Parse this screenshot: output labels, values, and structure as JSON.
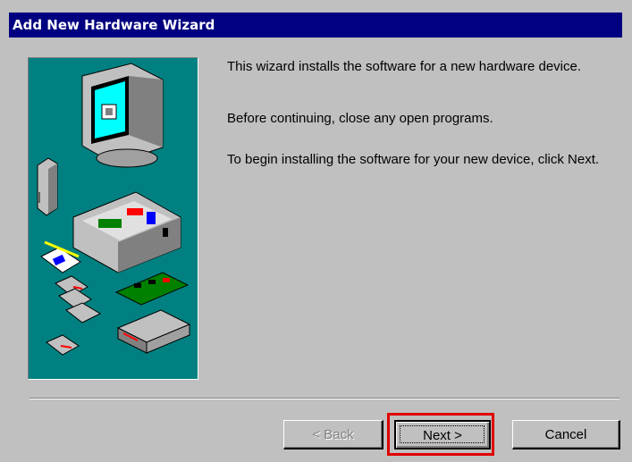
{
  "window": {
    "title": "Add New Hardware Wizard"
  },
  "body": {
    "paragraph1": "This wizard installs the software for a new hardware device.",
    "paragraph2": "Before continuing, close any open programs.",
    "paragraph3": "To begin installing the software for your new device, click Next."
  },
  "buttons": {
    "back": "< Back",
    "back_enabled": false,
    "next": "Next >",
    "cancel": "Cancel"
  },
  "colors": {
    "title_bar": "#000080",
    "illustration_bg": "#008080",
    "dialog_bg": "#c0c0c0",
    "highlight": "#e00000"
  },
  "icons": {
    "illustration": "hardware-illustration",
    "items": [
      "monitor-icon",
      "modem-icon",
      "computer-case-icon",
      "install-disk-icon",
      "floppy-disk-icon",
      "expansion-card-icon",
      "network-hub-icon"
    ]
  }
}
